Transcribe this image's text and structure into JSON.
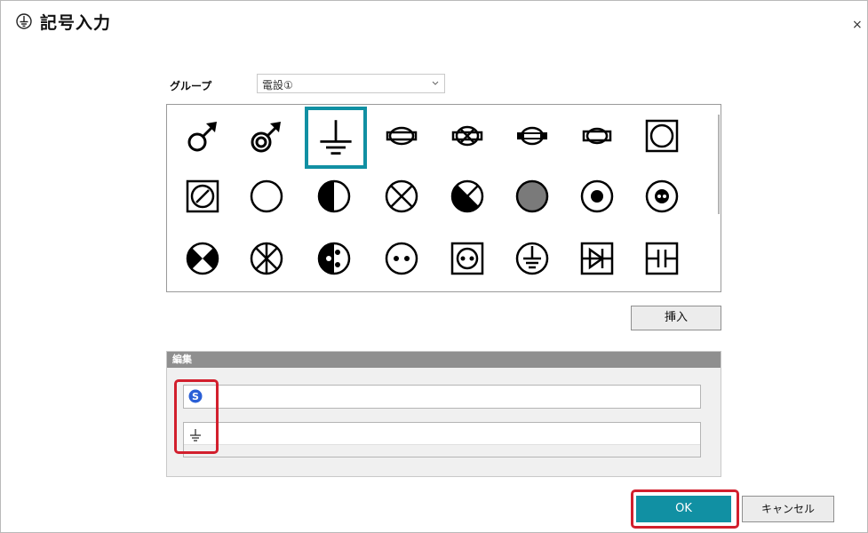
{
  "window": {
    "title": "記号入力",
    "close_label": "×"
  },
  "group": {
    "label": "グループ",
    "selected": "電設①"
  },
  "palette": {
    "selected_symbol": "earth-ground-symbol",
    "symbols": [
      "male-symbol",
      "male-double-ring-symbol",
      "earth-ground-symbol",
      "lamp-bar-symbol",
      "lamp-cross-bar-symbol",
      "lamp-filled-bar-symbol",
      "lamp-small-bar-symbol",
      "square-circle-symbol",
      "square-slash-circle-symbol",
      "circle-symbol",
      "half-filled-circle-symbol",
      "cross-circle-symbol",
      "quarter-filled-cross-circle-symbol",
      "hatched-circle-symbol",
      "dot-circle-symbol",
      "double-dot-ring-symbol",
      "bowtie-circle-symbol",
      "star-circle-symbol",
      "three-dot-circle-symbol",
      "two-dot-circle-symbol",
      "outlet-square-symbol",
      "ground-circle-symbol",
      "diode-square-symbol",
      "capacitor-square-symbol"
    ]
  },
  "buttons": {
    "insert": "挿入",
    "ok": "OK",
    "cancel": "キャンセル"
  },
  "edit": {
    "header": "編集",
    "field1_value": "",
    "field2_value": "⏚"
  },
  "colors": {
    "accent": "#1190a3",
    "highlight": "#d21f2d"
  }
}
